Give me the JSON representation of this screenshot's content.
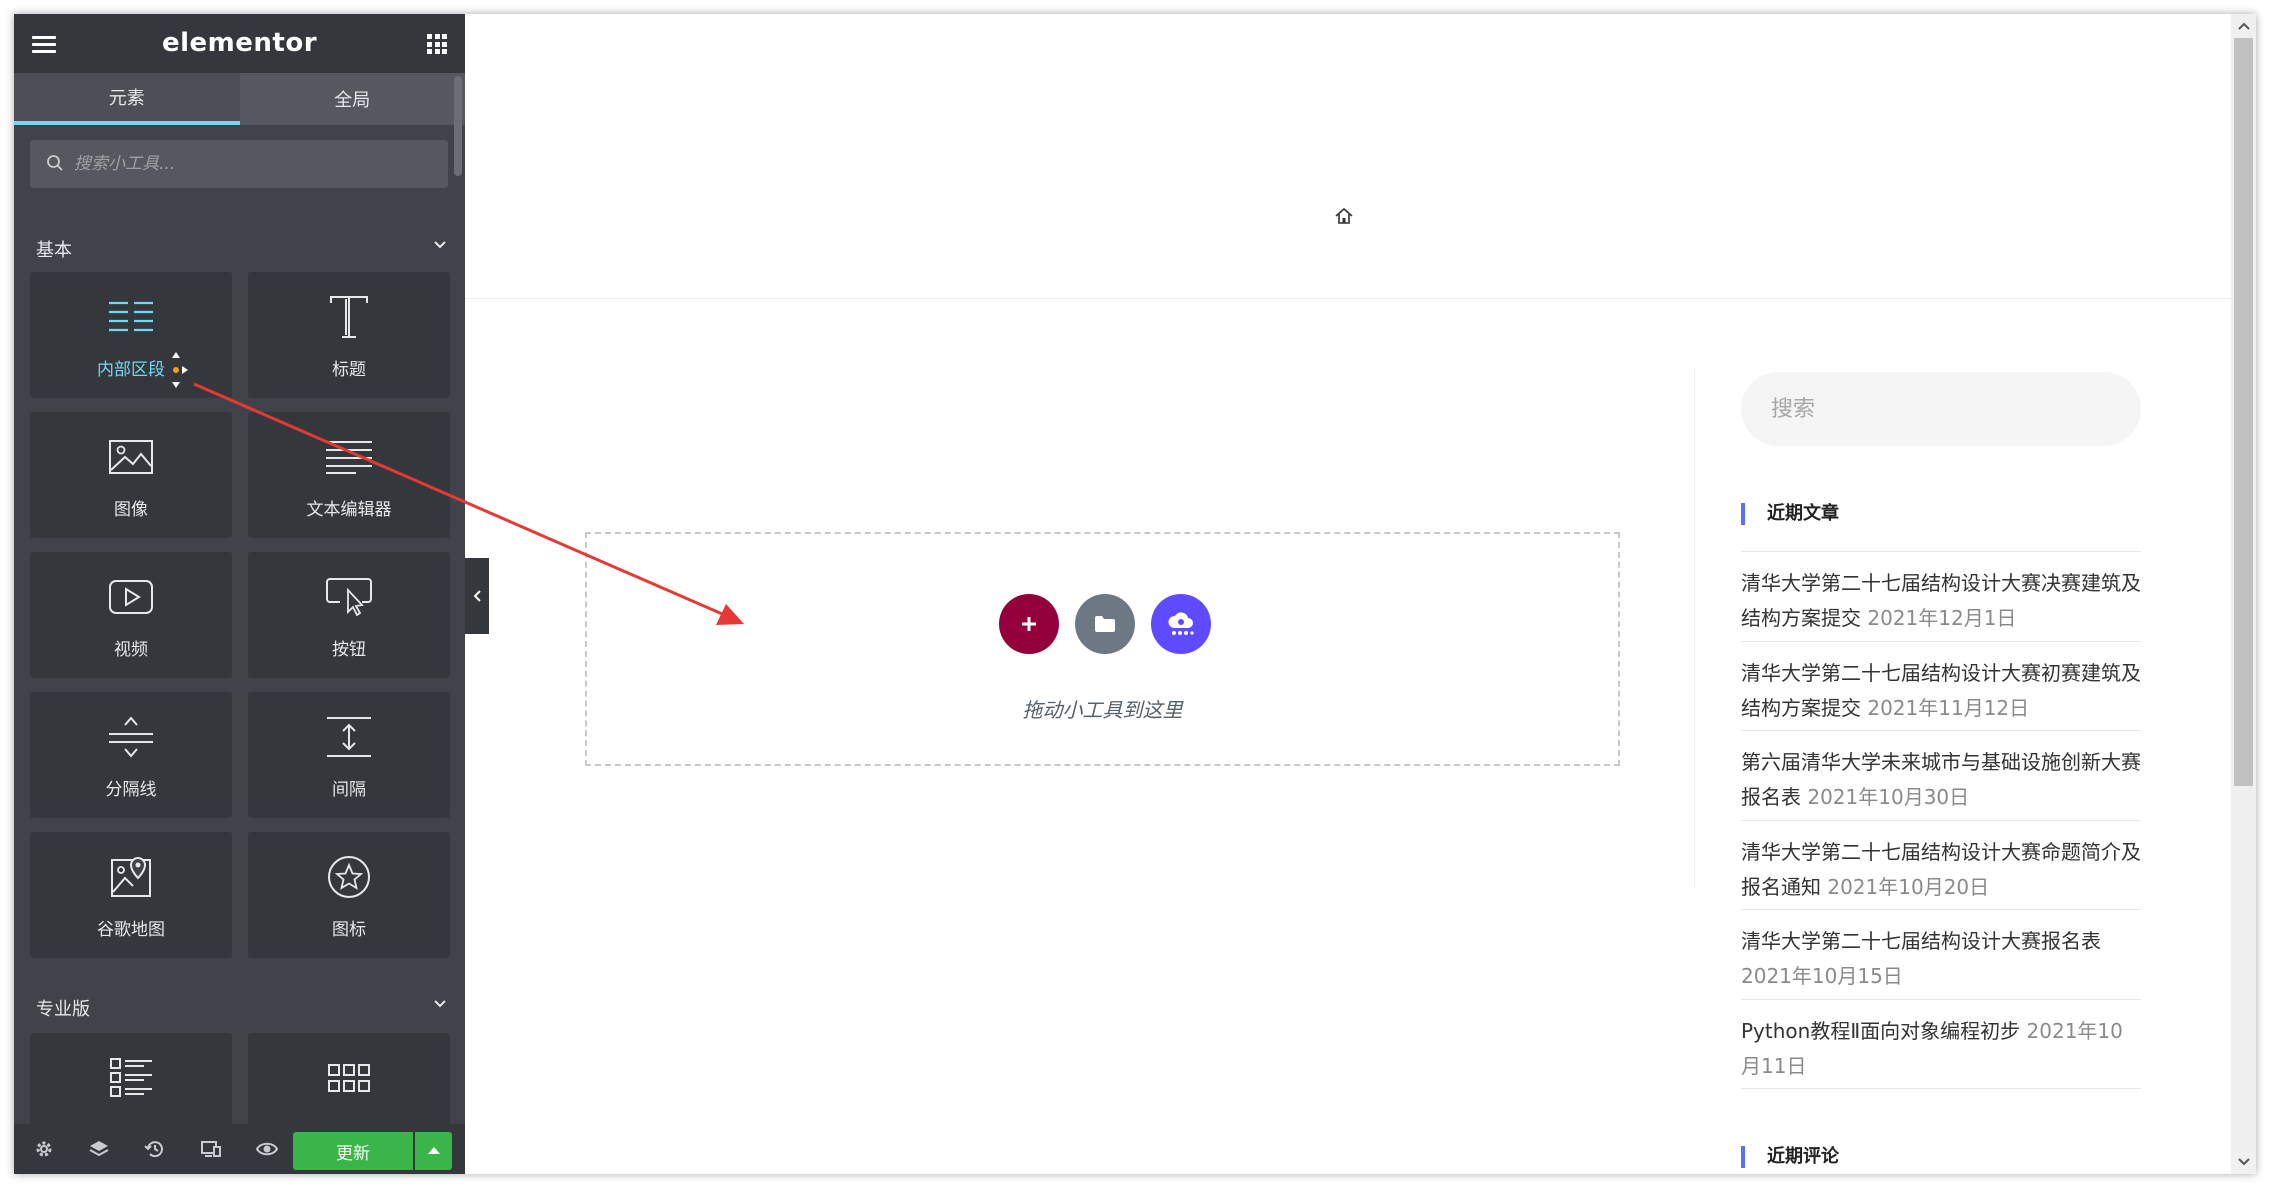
{
  "panel": {
    "logo": "elementor",
    "tabs": [
      {
        "label": "元素",
        "active": true
      },
      {
        "label": "全局",
        "active": false
      }
    ],
    "search_placeholder": "搜索小工具...",
    "categories": {
      "basic": "基本",
      "pro": "专业版"
    },
    "widgets": [
      {
        "label": "内部区段",
        "icon": "inner-section-icon"
      },
      {
        "label": "标题",
        "icon": "heading-icon"
      },
      {
        "label": "图像",
        "icon": "image-icon"
      },
      {
        "label": "文本编辑器",
        "icon": "text-editor-icon"
      },
      {
        "label": "视频",
        "icon": "video-icon"
      },
      {
        "label": "按钮",
        "icon": "button-icon"
      },
      {
        "label": "分隔线",
        "icon": "divider-icon"
      },
      {
        "label": "间隔",
        "icon": "spacer-icon"
      },
      {
        "label": "谷歌地图",
        "icon": "google-maps-icon"
      },
      {
        "label": "图标",
        "icon": "star-icon"
      }
    ],
    "pro_widgets": [
      {
        "label": "",
        "icon": "posts-list-icon"
      },
      {
        "label": "",
        "icon": "grid-icon"
      }
    ],
    "footer": {
      "update_label": "更新",
      "icons": [
        "settings-icon",
        "layers-icon",
        "history-icon",
        "responsive-icon",
        "preview-eye-icon"
      ]
    },
    "accent_color": "#71d7f7",
    "update_color": "#39b54a"
  },
  "canvas": {
    "drop_text": "拖动小工具到这里",
    "buttons": [
      {
        "name": "add-section",
        "color": "#93003c"
      },
      {
        "name": "add-template",
        "color": "#6d7882"
      },
      {
        "name": "elementor-kit",
        "color": "#5f4bff"
      }
    ]
  },
  "sidebar": {
    "search_placeholder": "搜索",
    "recent_posts_title": "近期文章",
    "posts": [
      {
        "title": "清华大学第二十七届结构设计大赛决赛建筑及结构方案提交",
        "date": "2021年12月1日"
      },
      {
        "title": "清华大学第二十七届结构设计大赛初赛建筑及结构方案提交",
        "date": "2021年11月12日"
      },
      {
        "title": "第六届清华大学未来城市与基础设施创新大赛报名表",
        "date": "2021年10月30日"
      },
      {
        "title": "清华大学第二十七届结构设计大赛命题简介及报名通知",
        "date": "2021年10月20日"
      },
      {
        "title": "清华大学第二十七届结构设计大赛报名表",
        "date": "2021年10月15日"
      },
      {
        "title": "Python教程Ⅱ面向对象编程初步",
        "date": "2021年10月11日"
      }
    ],
    "recent_comments_title": "近期评论",
    "accent_color": "#5b6ff5"
  }
}
